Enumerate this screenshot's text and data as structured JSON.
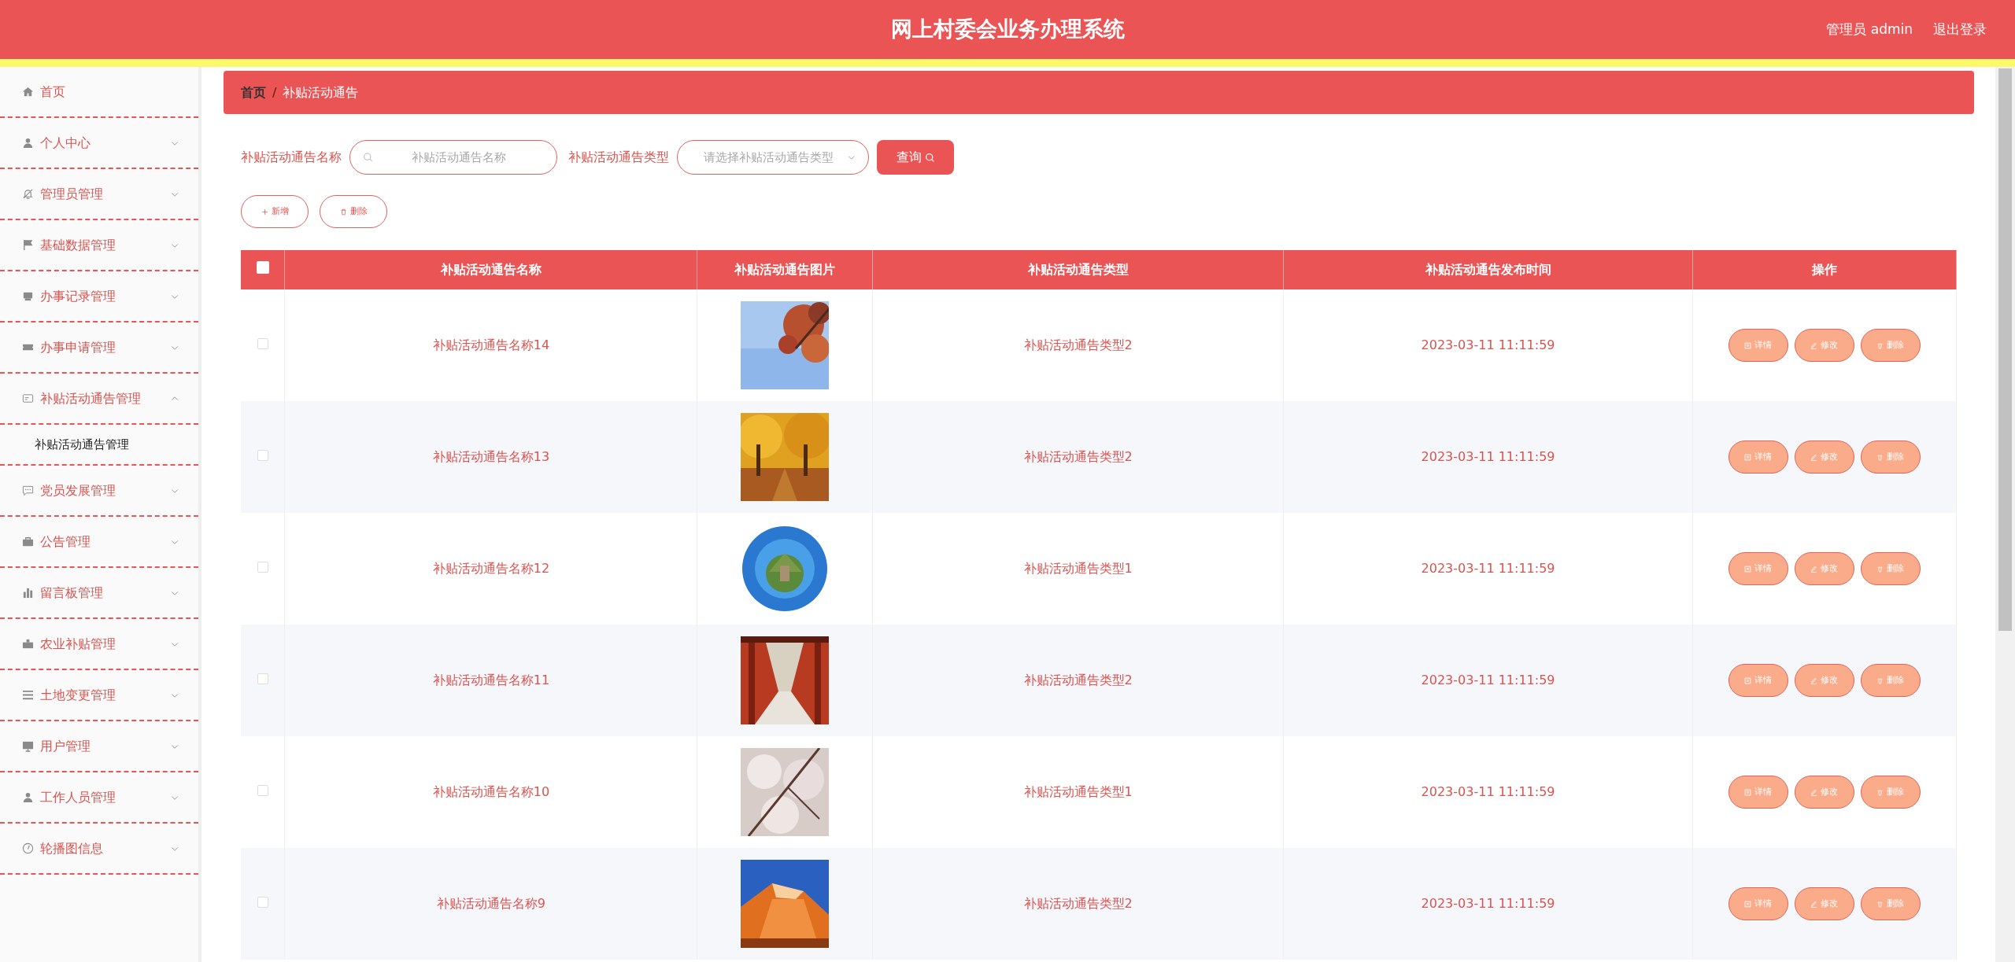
{
  "header": {
    "title": "网上村委会业务办理系统",
    "user": "管理员 admin",
    "logout": "退出登录"
  },
  "sidebar": {
    "items": [
      {
        "label": "首页",
        "kind": "link"
      },
      {
        "label": "个人中心",
        "kind": "menu",
        "expanded": false
      },
      {
        "label": "管理员管理",
        "kind": "menu",
        "expanded": false
      },
      {
        "label": "基础数据管理",
        "kind": "menu",
        "expanded": false
      },
      {
        "label": "办事记录管理",
        "kind": "menu",
        "expanded": false
      },
      {
        "label": "办事申请管理",
        "kind": "menu",
        "expanded": false
      },
      {
        "label": "补贴活动通告管理",
        "kind": "menu",
        "expanded": true,
        "children": [
          {
            "label": "补贴活动通告管理"
          }
        ]
      },
      {
        "label": "党员发展管理",
        "kind": "menu",
        "expanded": false
      },
      {
        "label": "公告管理",
        "kind": "menu",
        "expanded": false
      },
      {
        "label": "留言板管理",
        "kind": "menu",
        "expanded": false
      },
      {
        "label": "农业补贴管理",
        "kind": "menu",
        "expanded": false
      },
      {
        "label": "土地变更管理",
        "kind": "menu",
        "expanded": false
      },
      {
        "label": "用户管理",
        "kind": "menu",
        "expanded": false
      },
      {
        "label": "工作人员管理",
        "kind": "menu",
        "expanded": false
      },
      {
        "label": "轮播图信息",
        "kind": "menu",
        "expanded": false
      }
    ]
  },
  "breadcrumb": {
    "home": "首页",
    "separator": "/",
    "current": "补贴活动通告"
  },
  "search": {
    "name_label": "补贴活动通告名称",
    "name_placeholder": "补贴活动通告名称",
    "type_label": "补贴活动通告类型",
    "type_placeholder": "请选择补贴活动通告类型",
    "button": "查询"
  },
  "actions": [
    "新增",
    "删除"
  ],
  "table": {
    "select_all": {
      "checked": false
    },
    "columns": [
      "补贴活动通告名称",
      "补贴活动通告图片",
      "补贴活动通告类型",
      "补贴活动通告发布时间",
      "操作"
    ],
    "rows": [
      {
        "checked": false,
        "name": "补贴活动通告名称14",
        "type": "补贴活动通告类型2",
        "time": "2023-03-11 11:11:59",
        "buttons": [
          "详情",
          "修改",
          "删除"
        ]
      },
      {
        "checked": false,
        "name": "补贴活动通告名称13",
        "type": "补贴活动通告类型2",
        "time": "2023-03-11 11:11:59",
        "buttons": [
          "详情",
          "修改",
          "删除"
        ]
      },
      {
        "checked": false,
        "name": "补贴活动通告名称12",
        "type": "补贴活动通告类型1",
        "time": "2023-03-11 11:11:59",
        "buttons": [
          "详情",
          "修改",
          "删除"
        ]
      },
      {
        "checked": false,
        "name": "补贴活动通告名称11",
        "type": "补贴活动通告类型2",
        "time": "2023-03-11 11:11:59",
        "buttons": [
          "详情",
          "修改",
          "删除"
        ]
      },
      {
        "checked": false,
        "name": "补贴活动通告名称10",
        "type": "补贴活动通告类型1",
        "time": "2023-03-11 11:11:59",
        "buttons": [
          "详情",
          "修改",
          "删除"
        ]
      },
      {
        "checked": false,
        "name": "补贴活动通告名称9",
        "type": "补贴活动通告类型2",
        "time": "2023-03-11 11:11:59",
        "buttons": [
          "详情",
          "修改",
          "删除"
        ]
      }
    ]
  }
}
